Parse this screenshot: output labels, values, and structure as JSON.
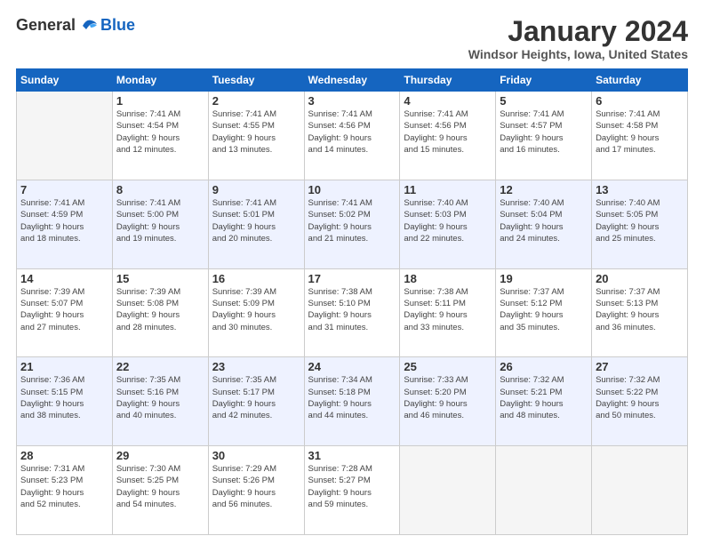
{
  "header": {
    "logo_general": "General",
    "logo_blue": "Blue",
    "month_title": "January 2024",
    "location": "Windsor Heights, Iowa, United States"
  },
  "days_of_week": [
    "Sunday",
    "Monday",
    "Tuesday",
    "Wednesday",
    "Thursday",
    "Friday",
    "Saturday"
  ],
  "weeks": [
    [
      {
        "day": "",
        "info": ""
      },
      {
        "day": "1",
        "info": "Sunrise: 7:41 AM\nSunset: 4:54 PM\nDaylight: 9 hours\nand 12 minutes."
      },
      {
        "day": "2",
        "info": "Sunrise: 7:41 AM\nSunset: 4:55 PM\nDaylight: 9 hours\nand 13 minutes."
      },
      {
        "day": "3",
        "info": "Sunrise: 7:41 AM\nSunset: 4:56 PM\nDaylight: 9 hours\nand 14 minutes."
      },
      {
        "day": "4",
        "info": "Sunrise: 7:41 AM\nSunset: 4:56 PM\nDaylight: 9 hours\nand 15 minutes."
      },
      {
        "day": "5",
        "info": "Sunrise: 7:41 AM\nSunset: 4:57 PM\nDaylight: 9 hours\nand 16 minutes."
      },
      {
        "day": "6",
        "info": "Sunrise: 7:41 AM\nSunset: 4:58 PM\nDaylight: 9 hours\nand 17 minutes."
      }
    ],
    [
      {
        "day": "7",
        "info": "Sunrise: 7:41 AM\nSunset: 4:59 PM\nDaylight: 9 hours\nand 18 minutes."
      },
      {
        "day": "8",
        "info": "Sunrise: 7:41 AM\nSunset: 5:00 PM\nDaylight: 9 hours\nand 19 minutes."
      },
      {
        "day": "9",
        "info": "Sunrise: 7:41 AM\nSunset: 5:01 PM\nDaylight: 9 hours\nand 20 minutes."
      },
      {
        "day": "10",
        "info": "Sunrise: 7:41 AM\nSunset: 5:02 PM\nDaylight: 9 hours\nand 21 minutes."
      },
      {
        "day": "11",
        "info": "Sunrise: 7:40 AM\nSunset: 5:03 PM\nDaylight: 9 hours\nand 22 minutes."
      },
      {
        "day": "12",
        "info": "Sunrise: 7:40 AM\nSunset: 5:04 PM\nDaylight: 9 hours\nand 24 minutes."
      },
      {
        "day": "13",
        "info": "Sunrise: 7:40 AM\nSunset: 5:05 PM\nDaylight: 9 hours\nand 25 minutes."
      }
    ],
    [
      {
        "day": "14",
        "info": "Sunrise: 7:39 AM\nSunset: 5:07 PM\nDaylight: 9 hours\nand 27 minutes."
      },
      {
        "day": "15",
        "info": "Sunrise: 7:39 AM\nSunset: 5:08 PM\nDaylight: 9 hours\nand 28 minutes."
      },
      {
        "day": "16",
        "info": "Sunrise: 7:39 AM\nSunset: 5:09 PM\nDaylight: 9 hours\nand 30 minutes."
      },
      {
        "day": "17",
        "info": "Sunrise: 7:38 AM\nSunset: 5:10 PM\nDaylight: 9 hours\nand 31 minutes."
      },
      {
        "day": "18",
        "info": "Sunrise: 7:38 AM\nSunset: 5:11 PM\nDaylight: 9 hours\nand 33 minutes."
      },
      {
        "day": "19",
        "info": "Sunrise: 7:37 AM\nSunset: 5:12 PM\nDaylight: 9 hours\nand 35 minutes."
      },
      {
        "day": "20",
        "info": "Sunrise: 7:37 AM\nSunset: 5:13 PM\nDaylight: 9 hours\nand 36 minutes."
      }
    ],
    [
      {
        "day": "21",
        "info": "Sunrise: 7:36 AM\nSunset: 5:15 PM\nDaylight: 9 hours\nand 38 minutes."
      },
      {
        "day": "22",
        "info": "Sunrise: 7:35 AM\nSunset: 5:16 PM\nDaylight: 9 hours\nand 40 minutes."
      },
      {
        "day": "23",
        "info": "Sunrise: 7:35 AM\nSunset: 5:17 PM\nDaylight: 9 hours\nand 42 minutes."
      },
      {
        "day": "24",
        "info": "Sunrise: 7:34 AM\nSunset: 5:18 PM\nDaylight: 9 hours\nand 44 minutes."
      },
      {
        "day": "25",
        "info": "Sunrise: 7:33 AM\nSunset: 5:20 PM\nDaylight: 9 hours\nand 46 minutes."
      },
      {
        "day": "26",
        "info": "Sunrise: 7:32 AM\nSunset: 5:21 PM\nDaylight: 9 hours\nand 48 minutes."
      },
      {
        "day": "27",
        "info": "Sunrise: 7:32 AM\nSunset: 5:22 PM\nDaylight: 9 hours\nand 50 minutes."
      }
    ],
    [
      {
        "day": "28",
        "info": "Sunrise: 7:31 AM\nSunset: 5:23 PM\nDaylight: 9 hours\nand 52 minutes."
      },
      {
        "day": "29",
        "info": "Sunrise: 7:30 AM\nSunset: 5:25 PM\nDaylight: 9 hours\nand 54 minutes."
      },
      {
        "day": "30",
        "info": "Sunrise: 7:29 AM\nSunset: 5:26 PM\nDaylight: 9 hours\nand 56 minutes."
      },
      {
        "day": "31",
        "info": "Sunrise: 7:28 AM\nSunset: 5:27 PM\nDaylight: 9 hours\nand 59 minutes."
      },
      {
        "day": "",
        "info": ""
      },
      {
        "day": "",
        "info": ""
      },
      {
        "day": "",
        "info": ""
      }
    ]
  ]
}
